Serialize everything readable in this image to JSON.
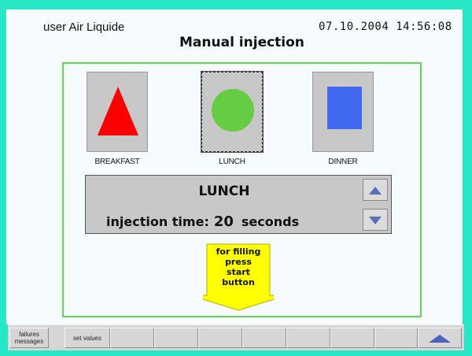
{
  "header": {
    "user": "user Air Liquide",
    "datetime": "07.10.2004 14:56:08",
    "title": "Manual injection"
  },
  "meals": [
    {
      "label": "BREAKFAST",
      "shape": "triangle",
      "color": "#ff0000",
      "selected": false
    },
    {
      "label": "LUNCH",
      "shape": "circle",
      "color": "#66cc44",
      "selected": true
    },
    {
      "label": "DINNER",
      "shape": "square",
      "color": "#4169f2",
      "selected": false
    }
  ],
  "info": {
    "selected_meal": "LUNCH",
    "injection_label": "injection time:",
    "injection_value": "20",
    "injection_unit": "seconds",
    "up_icon": "arrow-up-icon",
    "down_icon": "arrow-down-icon"
  },
  "start_hint": {
    "line1": "for filling",
    "line2": "press",
    "line3": "start",
    "line4": "button",
    "color": "#ffff00"
  },
  "toolbar": {
    "failures_line1": "failures",
    "failures_line2": "messages",
    "set_values": "set values",
    "scroll_up_icon": "arrow-up-icon"
  },
  "colors": {
    "frame": "#27e8c6",
    "panel_border": "#62d84f",
    "screen_bg": "#f6fcfe"
  }
}
